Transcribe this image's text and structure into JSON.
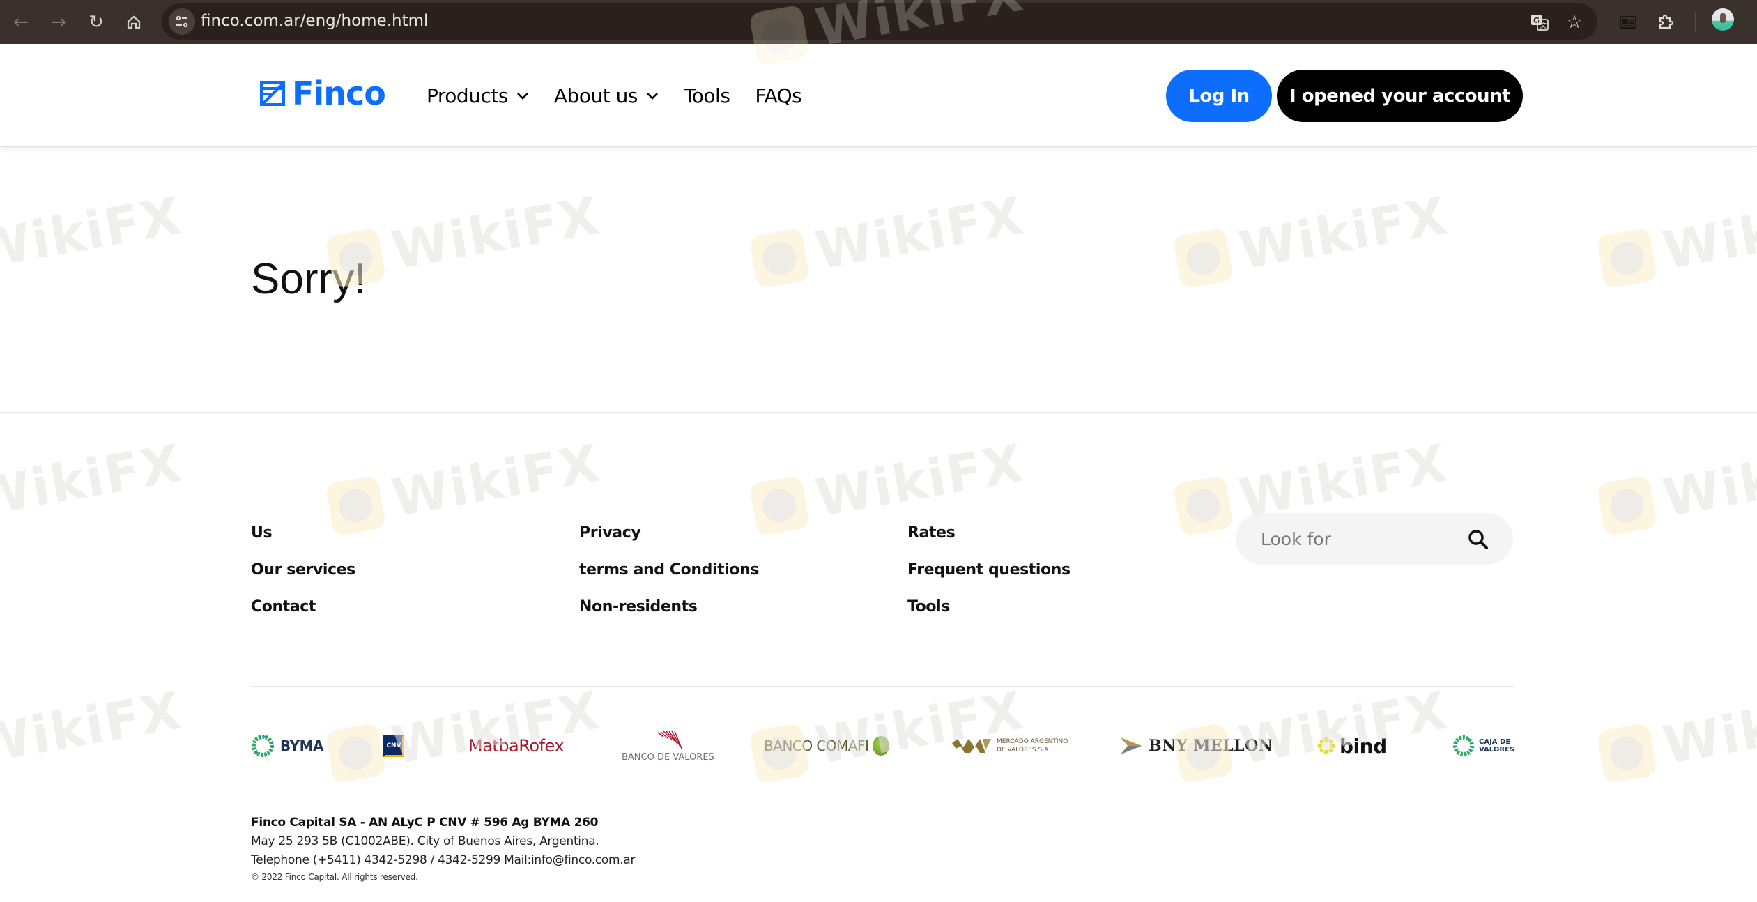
{
  "browser": {
    "url": "finco.com.ar/eng/home.html",
    "icons": [
      "back-icon",
      "forward-icon",
      "reload-icon",
      "home-icon",
      "site-info-icon",
      "translate-icon",
      "bookmark-star-icon",
      "reading-mode-icon",
      "extensions-icon",
      "profile-avatar"
    ]
  },
  "header": {
    "brand": "Finco",
    "brand_color": "#0d6efd",
    "nav": [
      {
        "label": "Products",
        "has_dropdown": true
      },
      {
        "label": "About us",
        "has_dropdown": true
      },
      {
        "label": "Tools",
        "has_dropdown": false
      },
      {
        "label": "FAQs",
        "has_dropdown": false
      }
    ],
    "login_label": "Log In",
    "open_account_label": "I opened your account"
  },
  "main": {
    "heading": "Sorry!"
  },
  "footer": {
    "columns": [
      [
        "Us",
        "Our services",
        "Contact"
      ],
      [
        "Privacy",
        "terms and Conditions",
        "Non-residents"
      ],
      [
        "Rates",
        "Frequent questions",
        "Tools"
      ]
    ],
    "search": {
      "placeholder": "Look for",
      "value": ""
    },
    "partners": {
      "byma": "BYMA",
      "cnv": "CNV",
      "matba": "MatbaRofex",
      "bdv": "BANCO DE VALORES",
      "comafi": "BANCO COMAFI",
      "mav_line1": "MERCADO ARGENTINO",
      "mav_line2": "DE VALORES S.A.",
      "bny": "BNY MELLON",
      "bind": "bind",
      "caja_line1": "CAJA DE",
      "caja_line2": "VALORES"
    },
    "legal": {
      "company": "Finco Capital SA - AN ALyC P CNV # 596 Ag BYMA 260",
      "address": "May 25 293 5B (C1002ABE). City of Buenos Aires, Argentina.",
      "contact": "Telephone (+5411) 4342-5298 / 4342-5299 Mail:info@finco.com.ar",
      "copyright": "© 2022 Finco Capital. All rights reserved."
    }
  },
  "watermark": {
    "text": "WikiFX"
  }
}
